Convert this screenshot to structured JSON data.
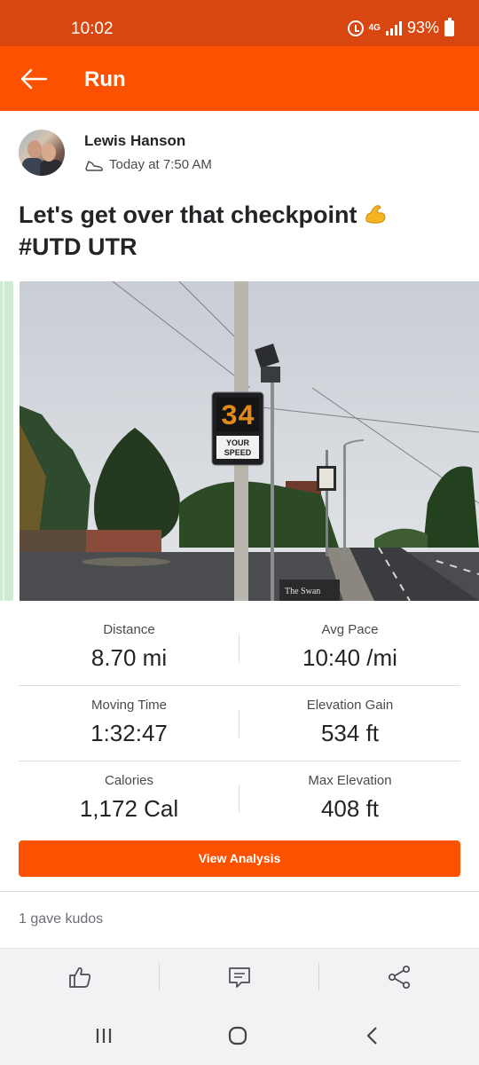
{
  "status_bar": {
    "time": "10:02",
    "network": "4G",
    "battery": "93%"
  },
  "app_bar": {
    "title": "Run"
  },
  "post": {
    "athlete": "Lewis Hanson",
    "timestamp": "Today at 7:50 AM",
    "title": "Let's get over that checkpoint",
    "title_emoji": "flexed-biceps",
    "hashtags": "#UTD UTR",
    "photo": {
      "sign_digits": "34",
      "sign_label_1": "YOUR",
      "sign_label_2": "SPEED",
      "pub_sign": "The Swan"
    }
  },
  "stats": {
    "distance_label": "Distance",
    "distance_value": "8.70 mi",
    "pace_label": "Avg Pace",
    "pace_value": "10:40 /mi",
    "moving_time_label": "Moving Time",
    "moving_time_value": "1:32:47",
    "elev_gain_label": "Elevation Gain",
    "elev_gain_value": "534 ft",
    "calories_label": "Calories",
    "calories_value": "1,172 Cal",
    "max_elev_label": "Max Elevation",
    "max_elev_value": "408 ft"
  },
  "analysis_button": "View Analysis",
  "kudos_text": "1 gave kudos",
  "colors": {
    "brand": "#fc5200",
    "status_bar": "#d8470f"
  },
  "icons": [
    "back-arrow-icon",
    "shoe-icon",
    "kudos-thumb-icon",
    "comment-icon",
    "share-icon",
    "recents-icon",
    "home-icon",
    "nav-back-icon"
  ]
}
